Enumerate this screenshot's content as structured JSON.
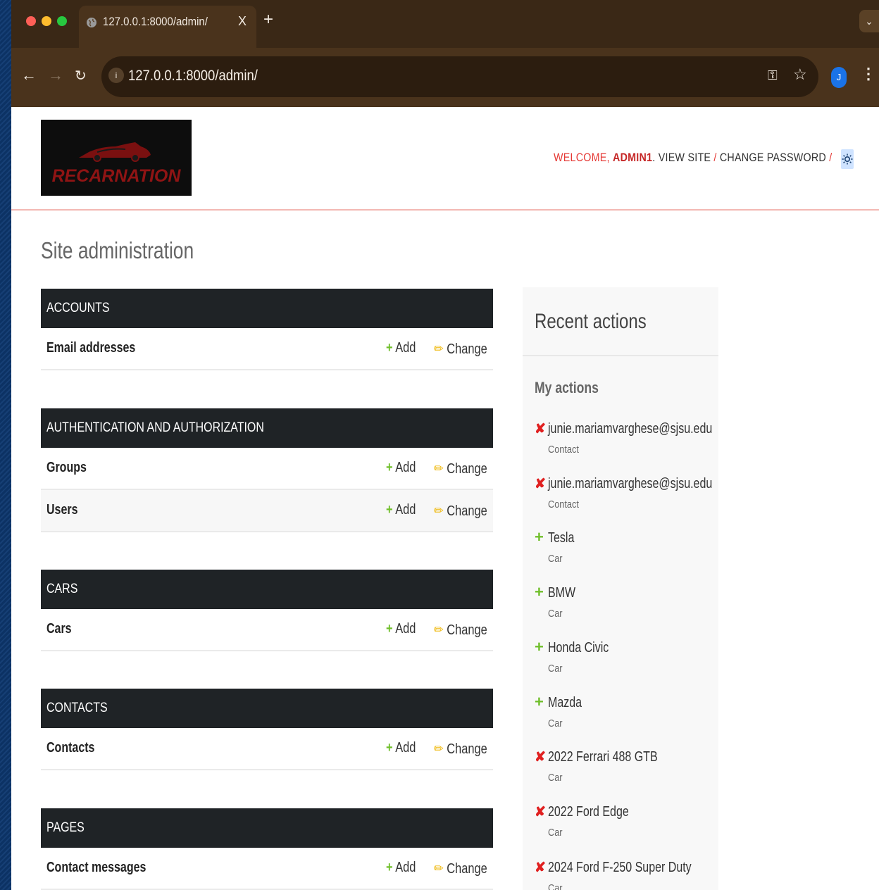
{
  "browser": {
    "tab_title": "127.0.0.1:8000/admin/",
    "tab_close": "X",
    "new_tab": "+",
    "url": "127.0.0.1:8000/admin/",
    "profile_initial": "J"
  },
  "header": {
    "logo_text": "RECARNATION",
    "welcome": "WELCOME,",
    "username": "ADMIN1",
    "view_site": "VIEW SITE",
    "separator": "/",
    "change_password": "CHANGE PASSWORD"
  },
  "page_title": "Site administration",
  "modules": [
    {
      "title": "ACCOUNTS",
      "rows": [
        {
          "name": "Email addresses",
          "add": "Add",
          "change": "Change"
        }
      ]
    },
    {
      "title": "AUTHENTICATION AND AUTHORIZATION",
      "rows": [
        {
          "name": "Groups",
          "add": "Add",
          "change": "Change"
        },
        {
          "name": "Users",
          "add": "Add",
          "change": "Change"
        }
      ]
    },
    {
      "title": "CARS",
      "rows": [
        {
          "name": "Cars",
          "add": "Add",
          "change": "Change"
        }
      ]
    },
    {
      "title": "CONTACTS",
      "rows": [
        {
          "name": "Contacts",
          "add": "Add",
          "change": "Change"
        }
      ]
    },
    {
      "title": "PAGES",
      "rows": [
        {
          "name": "Contact messages",
          "add": "Add",
          "change": "Change"
        }
      ]
    }
  ],
  "recent": {
    "title": "Recent actions",
    "subtitle": "My actions",
    "actions": [
      {
        "kind": "deletion",
        "icon": "✘",
        "text": "junie.mariamvarghese@sjsu.edu",
        "type": "Contact"
      },
      {
        "kind": "deletion",
        "icon": "✘",
        "text": "junie.mariamvarghese@sjsu.edu",
        "type": "Contact"
      },
      {
        "kind": "addition",
        "icon": "+",
        "text": "Tesla",
        "type": "Car"
      },
      {
        "kind": "addition",
        "icon": "+",
        "text": "BMW",
        "type": "Car"
      },
      {
        "kind": "addition",
        "icon": "+",
        "text": "Honda Civic",
        "type": "Car"
      },
      {
        "kind": "addition",
        "icon": "+",
        "text": "Mazda",
        "type": "Car"
      },
      {
        "kind": "deletion",
        "icon": "✘",
        "text": "2022 Ferrari 488 GTB",
        "type": "Car"
      },
      {
        "kind": "deletion",
        "icon": "✘",
        "text": "2022 Ford Edge",
        "type": "Car"
      },
      {
        "kind": "deletion",
        "icon": "✘",
        "text": "2024 Ford F-250 Super Duty",
        "type": "Car"
      }
    ]
  },
  "icons": {
    "add": "plus-icon",
    "change": "pencil-icon",
    "deletion": "delete-x-icon",
    "theme": "sun-icon"
  },
  "colors": {
    "module_header": "#1f2326",
    "accent_red": "#e53935",
    "add_green": "#70bf2b",
    "change_yellow": "#efb80b",
    "browser_chrome": "#4a331c"
  }
}
